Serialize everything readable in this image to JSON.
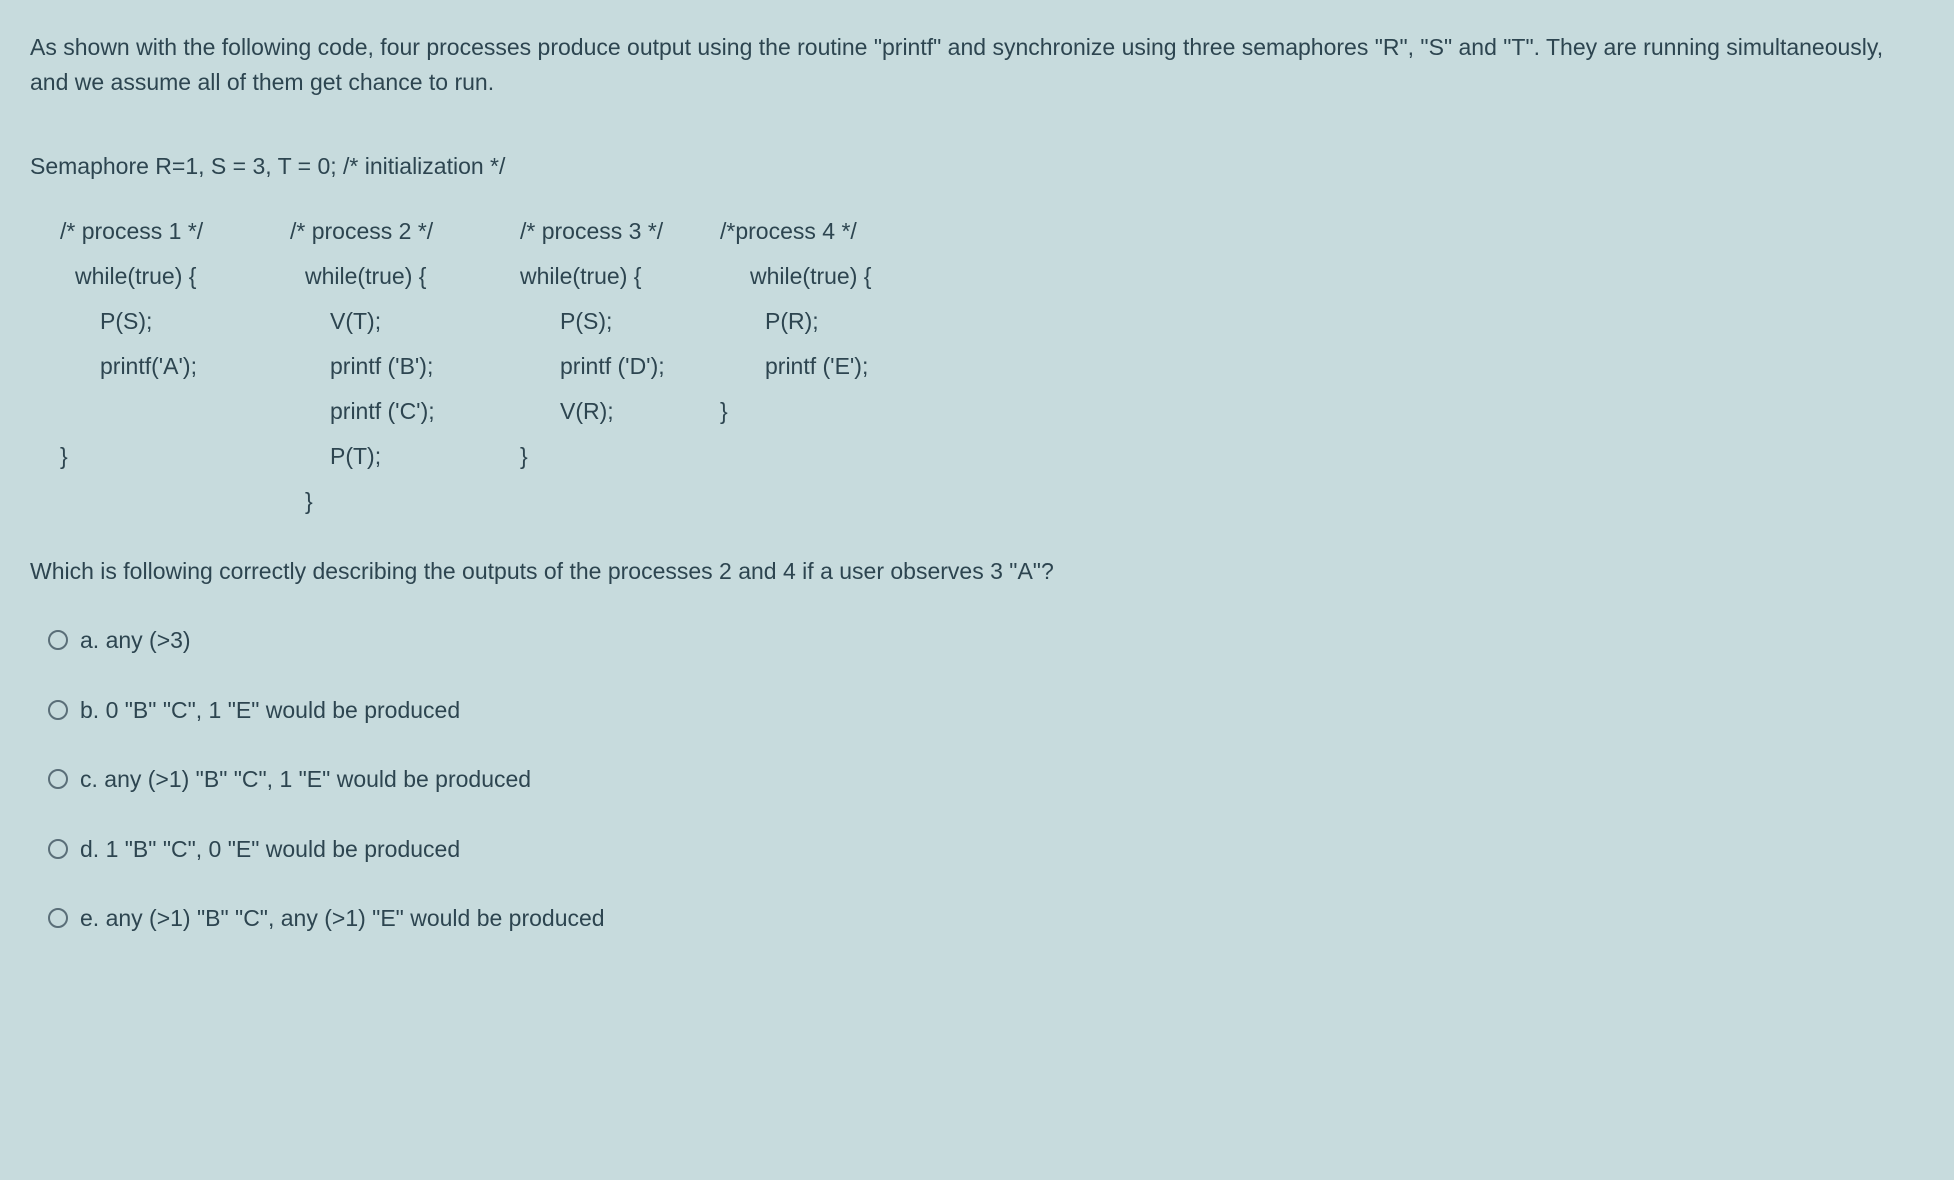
{
  "intro": "As shown with the following code, four processes produce output using the routine \"printf\" and synchronize using three semaphores \"R\", \"S\" and \"T\". They are running simultaneously, and we assume all of them get chance to run.",
  "semaphore_init": "Semaphore R=1, S = 3, T = 0; /* initialization */",
  "processes": {
    "p1": {
      "header": "/* process 1 */",
      "l1": "while(true) {",
      "l2": "P(S);",
      "l3": "printf('A');",
      "l4": "",
      "l5": "}",
      "l6": ""
    },
    "p2": {
      "header": "/* process 2 */",
      "l1": "while(true) {",
      "l2": "V(T);",
      "l3": "printf ('B');",
      "l4": "printf ('C');",
      "l5": "P(T);",
      "l6": "}"
    },
    "p3": {
      "header": "/* process 3 */",
      "l1": "while(true) {",
      "l2": "P(S);",
      "l3": "printf ('D');",
      "l4": "V(R);",
      "l5": "}",
      "l6": ""
    },
    "p4": {
      "header": "/*process 4 */",
      "l1": "while(true) {",
      "l2": "P(R);",
      "l3": "printf ('E');",
      "l4": "}",
      "l5": "",
      "l6": ""
    }
  },
  "question": "Which is following correctly describing the outputs of the processes 2 and 4 if a user observes 3 \"A\"?",
  "options": {
    "a": "a. any (>3)",
    "b": "b. 0 \"B\" \"C\", 1 \"E\" would be produced",
    "c": "c. any (>1) \"B\" \"C\", 1 \"E\" would be produced",
    "d": "d. 1 \"B\" \"C\", 0 \"E\" would be produced",
    "e": "e. any (>1) \"B\" \"C\", any (>1) \"E\" would be produced"
  }
}
